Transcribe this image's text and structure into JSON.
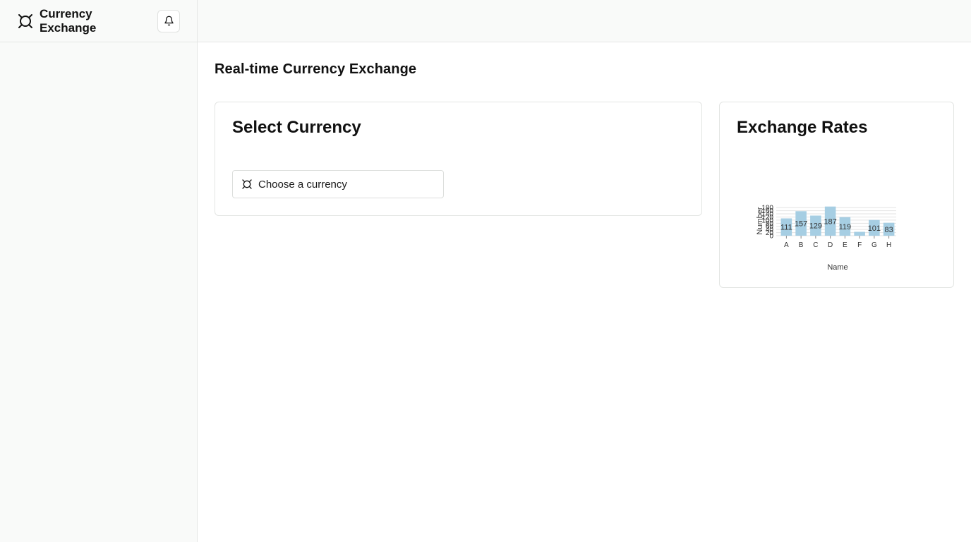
{
  "sidebar": {
    "brand_title": "Currency Exchange",
    "brand_icon": "currency-icon",
    "bell_icon": "bell-icon"
  },
  "main": {
    "page_title": "Real-time Currency Exchange"
  },
  "select_card": {
    "title": "Select Currency",
    "select_placeholder": "Choose a currency",
    "select_icon": "currency-icon"
  },
  "rates_card": {
    "title": "Exchange Rates"
  },
  "colors": {
    "bar": "#a6cee3",
    "grid": "#e3e3e3"
  },
  "chart_data": {
    "type": "bar",
    "categories": [
      "A",
      "B",
      "C",
      "D",
      "E",
      "F",
      "G",
      "H"
    ],
    "values": [
      111,
      157,
      129,
      187,
      119,
      25,
      101,
      83
    ],
    "value_labels": [
      "111",
      "157",
      "129",
      "187",
      "119",
      "",
      "101",
      "83"
    ],
    "xlabel": "Name",
    "ylabel": "Number",
    "ylim": [
      0,
      190
    ],
    "yticks": [
      0,
      20,
      40,
      60,
      80,
      100,
      120,
      140,
      160,
      180
    ],
    "grid": true
  }
}
